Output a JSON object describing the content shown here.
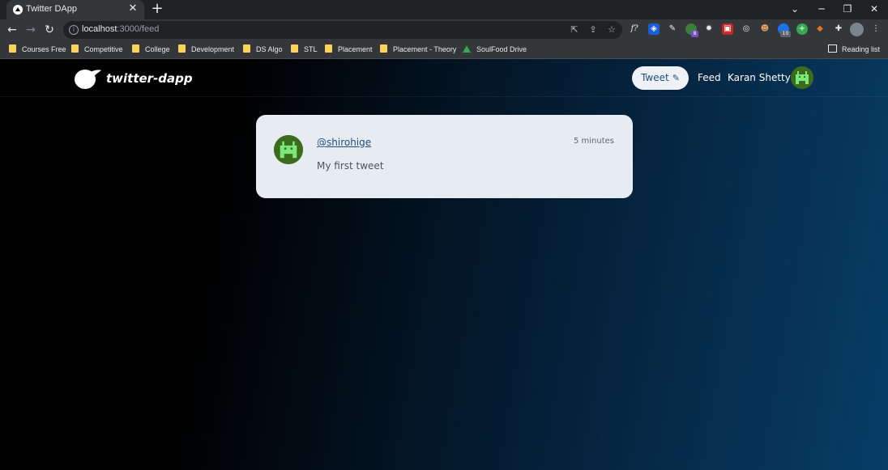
{
  "browser": {
    "tab_title": "Twitter DApp",
    "tab_close": "✕",
    "new_tab": "+",
    "url_host": "localhost",
    "url_path": ":3000/feed",
    "bookmarks": [
      {
        "label": "Courses Free"
      },
      {
        "label": "Competitive"
      },
      {
        "label": "College"
      },
      {
        "label": "Development"
      },
      {
        "label": "DS Algo"
      },
      {
        "label": "STL"
      },
      {
        "label": "Placement"
      },
      {
        "label": "Placement - Theory"
      },
      {
        "label": "SoulFood Drive"
      }
    ],
    "reading_list": "Reading list",
    "extensions": {
      "f_label": "f?",
      "badge_8": "8",
      "badge_10": "10"
    }
  },
  "app": {
    "logo_text": "twitter-dapp",
    "tweet_button": "Tweet",
    "nav_feed": "Feed",
    "nav_user": "Karan Shetty",
    "accent_color": "#1e4f7a",
    "avatar_color": "#3d6b1e"
  },
  "feed": {
    "tweets": [
      {
        "handle": "@shirohige",
        "time": "5 minutes",
        "text": "My first tweet"
      }
    ]
  }
}
